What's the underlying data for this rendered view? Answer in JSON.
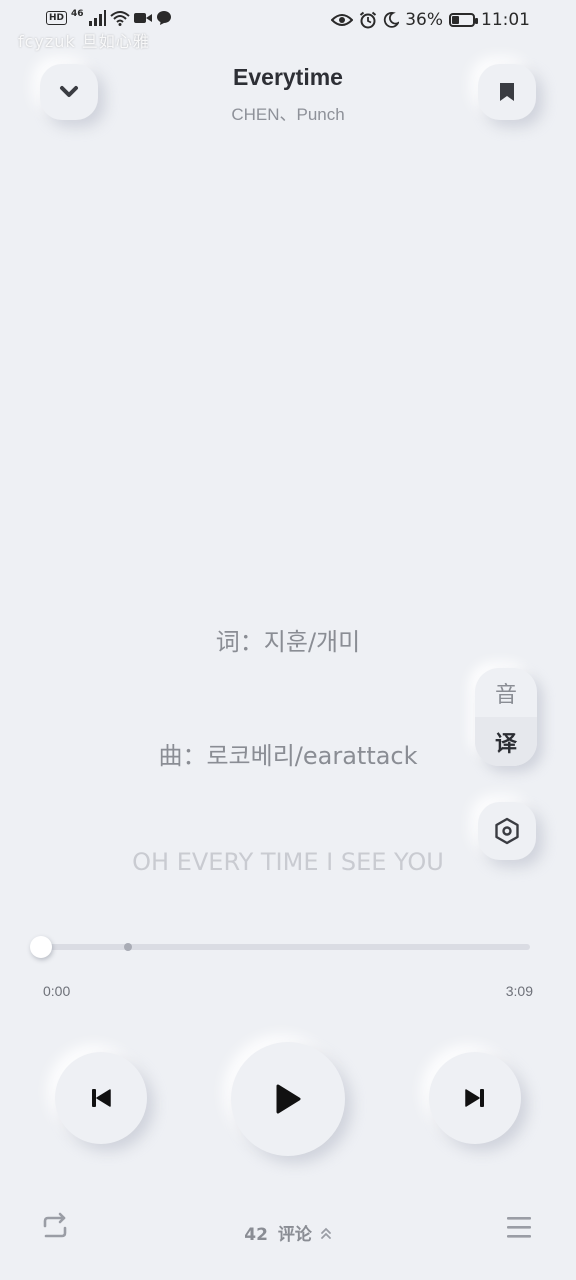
{
  "status_bar": {
    "hd": "HD",
    "network": "46",
    "battery_percent_label": "36%",
    "battery_level": 0.36,
    "time": "11:01",
    "watermark": "fcyzuk 旦如心雅"
  },
  "header": {
    "title": "Everytime",
    "subtitle": "CHEN、Punch"
  },
  "lyrics": {
    "lines": [
      "词：지훈/개미",
      "曲：로코베리/earattack",
      "OH EVERY TIME I SEE YOU"
    ]
  },
  "side_controls": {
    "original_label": "音",
    "translate_label": "译"
  },
  "player": {
    "current_time": "0:00",
    "total_time": "3:09",
    "progress": 0,
    "buffered": 0.18
  },
  "bottom": {
    "comment_count": "42",
    "comment_label": "评论"
  },
  "icons": {
    "collapse": "chevron-down-icon",
    "bookmark": "bookmark-icon",
    "settings": "hexagon-settings-icon",
    "previous": "skip-previous-icon",
    "play": "play-icon",
    "next": "skip-next-icon",
    "repeat": "repeat-icon",
    "playlist": "playlist-icon"
  }
}
